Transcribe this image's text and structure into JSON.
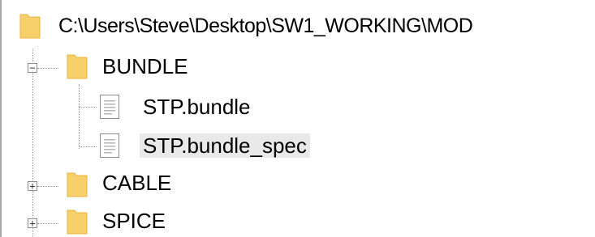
{
  "tree": {
    "root": {
      "label": "C:\\Users\\Steve\\Desktop\\SW1_WORKING\\MOD",
      "icon": "folder-icon"
    },
    "nodes": [
      {
        "label": "BUNDLE",
        "icon": "folder-icon",
        "expander": "−",
        "expanded": true,
        "children": [
          {
            "label": "STP.bundle",
            "icon": "document-icon"
          },
          {
            "label": "STP.bundle_spec",
            "icon": "document-icon",
            "selected": true
          }
        ]
      },
      {
        "label": "CABLE",
        "icon": "folder-icon",
        "expander": "+",
        "expanded": false
      },
      {
        "label": "SPICE",
        "icon": "folder-icon",
        "expander": "+",
        "expanded": false
      }
    ]
  },
  "colors": {
    "folder_fill": "#f7cf6b",
    "folder_edge": "#e4b440",
    "selection_bg": "#e9e9e9",
    "guide_line": "#9a9a9a"
  }
}
